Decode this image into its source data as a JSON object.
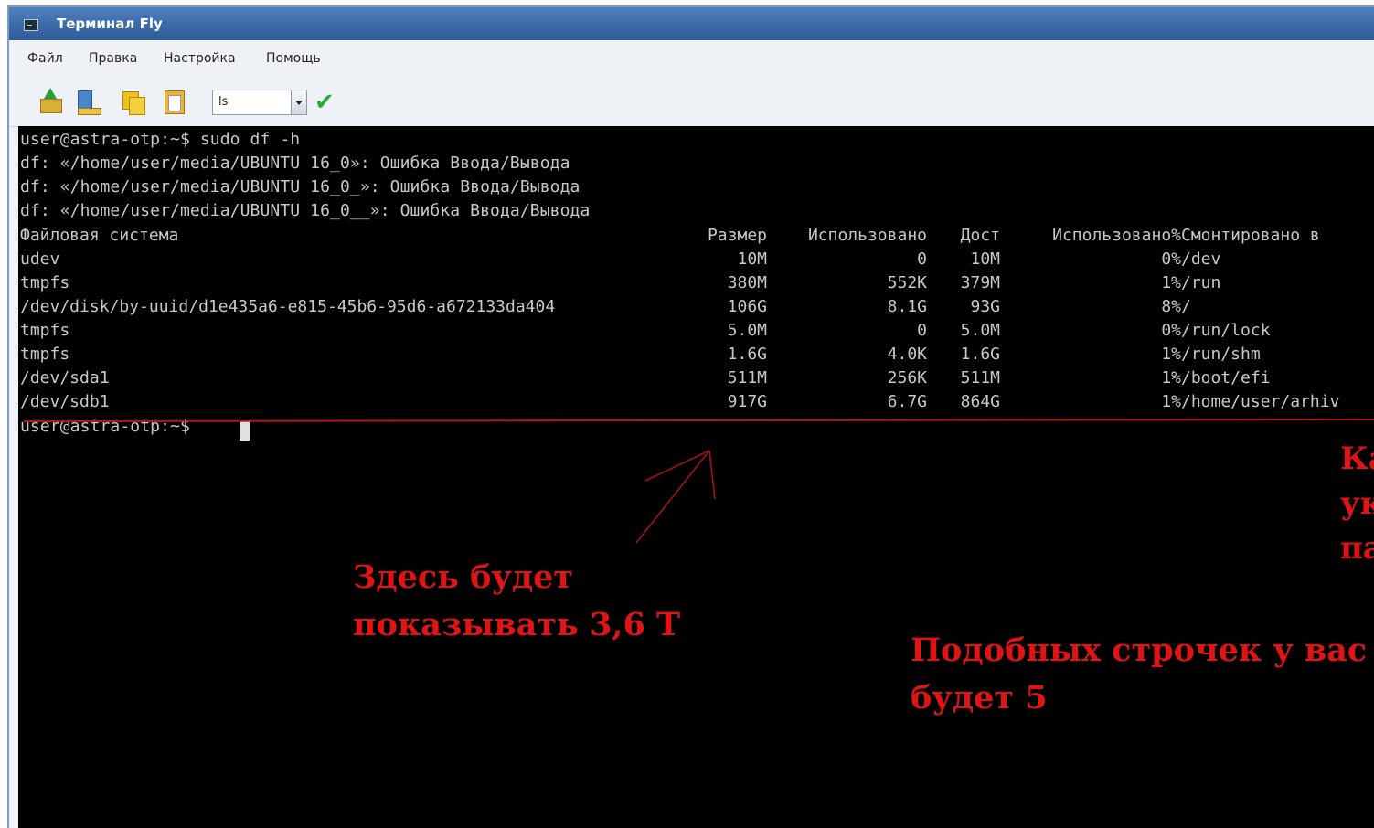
{
  "window": {
    "title": "Терминал Fly"
  },
  "menu": [
    "Файл",
    "Правка",
    "Настройка",
    "Помощь"
  ],
  "toolbar": {
    "command_value": "ls",
    "buttons": [
      "upload-icon",
      "download-icon",
      "copy-icon",
      "paste-icon"
    ],
    "run_icon": "checkmark-icon"
  },
  "terminal": {
    "prompt_line": "user@astra-otp:~$ sudo df -h",
    "errors": [
      "df: «/home/user/media/UBUNTU 16_0»: Ошибка Ввода/Вывода",
      "df: «/home/user/media/UBUNTU 16_0_»: Ошибка Ввода/Вывода",
      "df: «/home/user/media/UBUNTU 16_0__»: Ошибка Ввода/Вывода"
    ],
    "headers": [
      "Файловая система",
      "Размер",
      "Использовано",
      "Дост",
      "Использовано%",
      "Смонтировано в"
    ],
    "rows": [
      [
        "udev",
        "10M",
        "0",
        "10M",
        "0%",
        "/dev"
      ],
      [
        "tmpfs",
        "380M",
        "552K",
        "379M",
        "1%",
        "/run"
      ],
      [
        "/dev/disk/by-uuid/d1e435a6-e815-45b6-95d6-a672133da404",
        "106G",
        "8.1G",
        "93G",
        "8%",
        "/"
      ],
      [
        "tmpfs",
        "5.0M",
        "0",
        "5.0M",
        "0%",
        "/run/lock"
      ],
      [
        "tmpfs",
        "1.6G",
        "4.0K",
        "1.6G",
        "1%",
        "/run/shm"
      ],
      [
        "/dev/sda1",
        "511M",
        "256K",
        "511M",
        "1%",
        "/boot/efi"
      ],
      [
        "/dev/sdb1",
        "917G",
        "6.7G",
        "864G",
        "1%",
        "/home/user/arhiv"
      ]
    ],
    "final_prompt": "user@astra-otp:~$ "
  },
  "annotations": {
    "here_will_show": [
      "Здесь будет",
      "показывать 3,6 Т"
    ],
    "similar_lines": [
      "Подобных строчек у вас",
      "будет 5"
    ],
    "edge_fragments": [
      "Ка",
      "ук",
      "па"
    ]
  },
  "colors": {
    "terminal_bg": "#000000",
    "terminal_text": "#c8c8c8",
    "annotation": "#e01414",
    "titlebar": "#3a6aa8"
  }
}
